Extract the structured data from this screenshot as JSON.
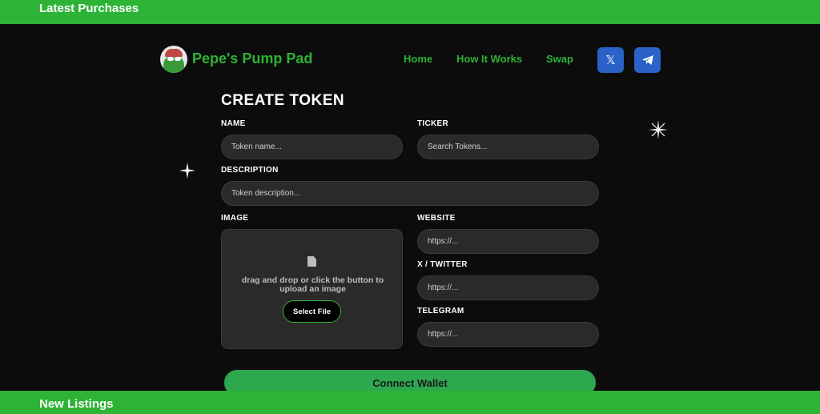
{
  "top_bar": {
    "label": "Latest Purchases"
  },
  "bottom_bar": {
    "label": "New Listings"
  },
  "header": {
    "brand": "Pepe's Pump Pad",
    "nav": {
      "home": "Home",
      "how": "How It Works",
      "swap": "Swap"
    },
    "social": {
      "x_icon": "𝕏",
      "telegram_icon": "➤"
    }
  },
  "form": {
    "title": "CREATE TOKEN",
    "name": {
      "label": "NAME",
      "placeholder": "Token name..."
    },
    "ticker": {
      "label": "TICKER",
      "placeholder": "Search Tokens..."
    },
    "description": {
      "label": "DESCRIPTION",
      "placeholder": "Token description..."
    },
    "image": {
      "label": "IMAGE",
      "hint": "drag and drop or click the button to upload an image",
      "button": "Select File"
    },
    "website": {
      "label": "WEBSITE",
      "placeholder": "https://..."
    },
    "twitter": {
      "label": "X / TWITTER",
      "placeholder": "https://..."
    },
    "telegram": {
      "label": "TELEGRAM",
      "placeholder": "https://..."
    },
    "connect": "Connect Wallet"
  },
  "colors": {
    "accent": "#2db336",
    "background": "#0c0c0c",
    "social": "#2b62c8"
  }
}
